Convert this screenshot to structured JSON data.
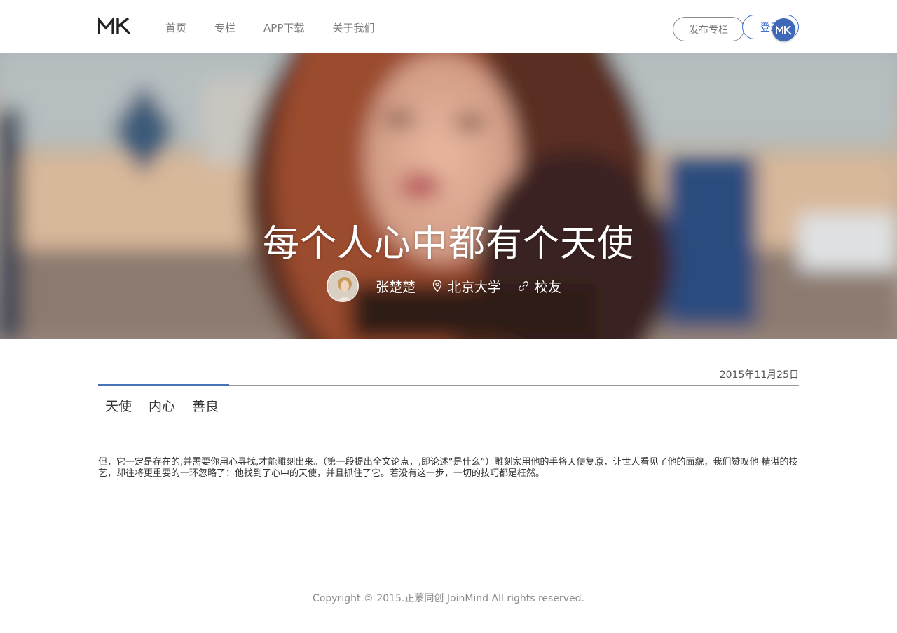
{
  "header": {
    "logo_text": "MK",
    "nav": [
      {
        "label": "首页"
      },
      {
        "label": "专栏"
      },
      {
        "label": "APP下载"
      },
      {
        "label": "关于我们"
      }
    ],
    "publish_label": "发布专栏",
    "login_label": "登录",
    "badge_text": "MK"
  },
  "hero": {
    "title": "每个人心中都有个天使",
    "author": "张楚楚",
    "location": "北京大学",
    "relation": "校友"
  },
  "article": {
    "date": "2015年11月25日",
    "tags": [
      "天使",
      "内心",
      "善良"
    ],
    "body": "但，它一定是存在的,并需要你用心寻找,才能雕刻出来。（第一段提出全文论点，,即论述“是什么”）雕刻家用他的手将天使复原，让世人看见了他的面貌，我们赞叹他 精湛的技艺，却往将更重要的一环忽略了：他找到了心中的天使，并且抓住了它。若没有这一步，一切的技巧都是枉然。"
  },
  "footer": {
    "copyright": "Copyright © 2015.正蒙同创 JoinMind All rights reserved."
  },
  "colors": {
    "accent": "#4a72b8",
    "login": "#2f63c4"
  }
}
